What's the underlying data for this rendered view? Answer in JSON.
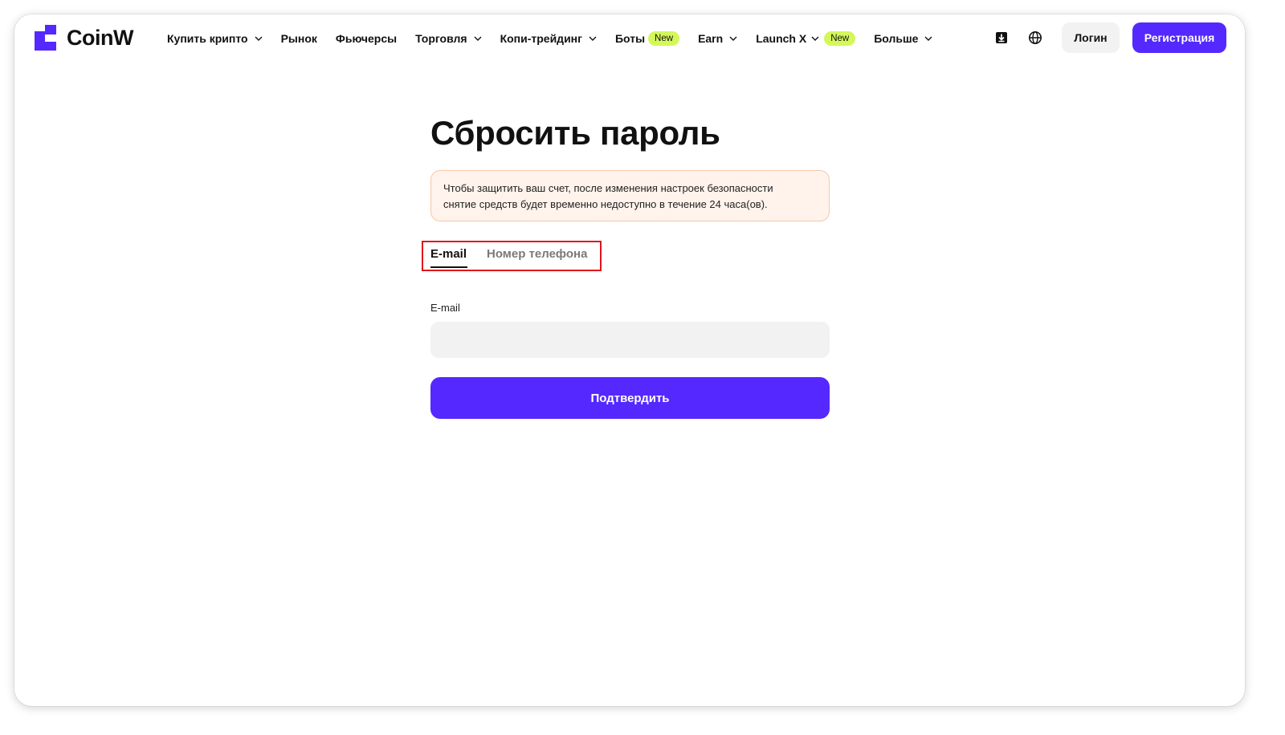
{
  "header": {
    "logo_text": "CoinW",
    "nav": [
      {
        "label": "Купить крипто",
        "dropdown": true
      },
      {
        "label": "Рынок"
      },
      {
        "label": "Фьючерсы"
      },
      {
        "label": "Торговля",
        "dropdown": true
      },
      {
        "label": "Копи-трейдинг",
        "dropdown": true
      },
      {
        "label": "Боты",
        "badge": "New"
      },
      {
        "label": "Earn",
        "dropdown": true
      },
      {
        "label": "Launch X",
        "dropdown": true,
        "badge": "New"
      },
      {
        "label": "Больше",
        "dropdown": true
      }
    ],
    "icons": [
      "download-icon",
      "globe-icon"
    ],
    "login_label": "Логин",
    "register_label": "Регистрация"
  },
  "main": {
    "title": "Сбросить пароль",
    "notice_line1": "Чтобы защитить ваш счет, после изменения настроек безопасности",
    "notice_line2": "снятие средств будет временно недоступно в течение 24 часа(ов).",
    "tabs": [
      {
        "label": "E-mail",
        "active": true
      },
      {
        "label": "Номер телефона",
        "active": false
      }
    ],
    "email_label": "E-mail",
    "email_value": "",
    "confirm_label": "Подтвердить"
  },
  "colors": {
    "accent": "#5528ff",
    "badge": "#d4f75a",
    "notice_bg": "#fff3ec",
    "notice_border": "#f7c7a8",
    "highlight_border": "#e0141b"
  }
}
